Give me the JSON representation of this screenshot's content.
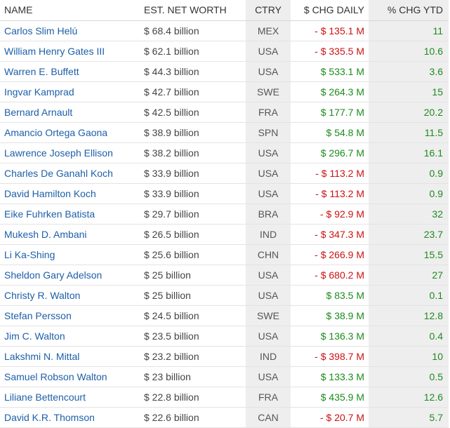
{
  "headers": {
    "name": "NAME",
    "worth": "EST. NET WORTH",
    "ctry": "CTRY",
    "chg": "$ CHG DAILY",
    "ytd": "% CHG YTD"
  },
  "colors": {
    "link": "#1d5fa8",
    "negative": "#cc1111",
    "positive": "#1e8a1e",
    "shaded_column": "#eeeeee"
  },
  "rows": [
    {
      "name": "Carlos Slim Helú",
      "worth": "$ 68.4 billion",
      "ctry": "MEX",
      "chg": "- $ 135.1 M",
      "ytd": "11"
    },
    {
      "name": "William Henry Gates III",
      "worth": "$ 62.1 billion",
      "ctry": "USA",
      "chg": "- $ 335.5 M",
      "ytd": "10.6"
    },
    {
      "name": "Warren E. Buffett",
      "worth": "$ 44.3 billion",
      "ctry": "USA",
      "chg": "$ 533.1 M",
      "ytd": "3.6"
    },
    {
      "name": "Ingvar Kamprad",
      "worth": "$ 42.7 billion",
      "ctry": "SWE",
      "chg": "$ 264.3 M",
      "ytd": "15"
    },
    {
      "name": "Bernard Arnault",
      "worth": "$ 42.5 billion",
      "ctry": "FRA",
      "chg": "$ 177.7 M",
      "ytd": "20.2"
    },
    {
      "name": "Amancio Ortega Gaona",
      "worth": "$ 38.9 billion",
      "ctry": "SPN",
      "chg": "$ 54.8 M",
      "ytd": "11.5"
    },
    {
      "name": "Lawrence Joseph Ellison",
      "worth": "$ 38.2 billion",
      "ctry": "USA",
      "chg": "$ 296.7 M",
      "ytd": "16.1"
    },
    {
      "name": "Charles De Ganahl Koch",
      "worth": "$ 33.9 billion",
      "ctry": "USA",
      "chg": "- $ 113.2 M",
      "ytd": "0.9"
    },
    {
      "name": "David Hamilton Koch",
      "worth": "$ 33.9 billion",
      "ctry": "USA",
      "chg": "- $ 113.2 M",
      "ytd": "0.9"
    },
    {
      "name": "Eike Fuhrken Batista",
      "worth": "$ 29.7 billion",
      "ctry": "BRA",
      "chg": "- $ 92.9 M",
      "ytd": "32"
    },
    {
      "name": "Mukesh D. Ambani",
      "worth": "$ 26.5 billion",
      "ctry": "IND",
      "chg": "- $ 347.3 M",
      "ytd": "23.7"
    },
    {
      "name": "Li Ka-Shing",
      "worth": "$ 25.6 billion",
      "ctry": "CHN",
      "chg": "- $ 266.9 M",
      "ytd": "15.5"
    },
    {
      "name": "Sheldon Gary Adelson",
      "worth": "$ 25 billion",
      "ctry": "USA",
      "chg": "- $ 680.2 M",
      "ytd": "27"
    },
    {
      "name": "Christy R. Walton",
      "worth": "$ 25 billion",
      "ctry": "USA",
      "chg": "$ 83.5 M",
      "ytd": "0.1"
    },
    {
      "name": "Stefan Persson",
      "worth": "$ 24.5 billion",
      "ctry": "SWE",
      "chg": "$ 38.9 M",
      "ytd": "12.8"
    },
    {
      "name": "Jim C. Walton",
      "worth": "$ 23.5 billion",
      "ctry": "USA",
      "chg": "$ 136.3 M",
      "ytd": "0.4"
    },
    {
      "name": "Lakshmi N. Mittal",
      "worth": "$ 23.2 billion",
      "ctry": "IND",
      "chg": "- $ 398.7 M",
      "ytd": "10"
    },
    {
      "name": "Samuel Robson Walton",
      "worth": "$ 23 billion",
      "ctry": "USA",
      "chg": "$ 133.3 M",
      "ytd": "0.5"
    },
    {
      "name": "Liliane Bettencourt",
      "worth": "$ 22.8 billion",
      "ctry": "FRA",
      "chg": "$ 435.9 M",
      "ytd": "12.6"
    },
    {
      "name": "David K.R. Thomson",
      "worth": "$ 22.6 billion",
      "ctry": "CAN",
      "chg": "- $ 20.7 M",
      "ytd": "5.7"
    }
  ]
}
